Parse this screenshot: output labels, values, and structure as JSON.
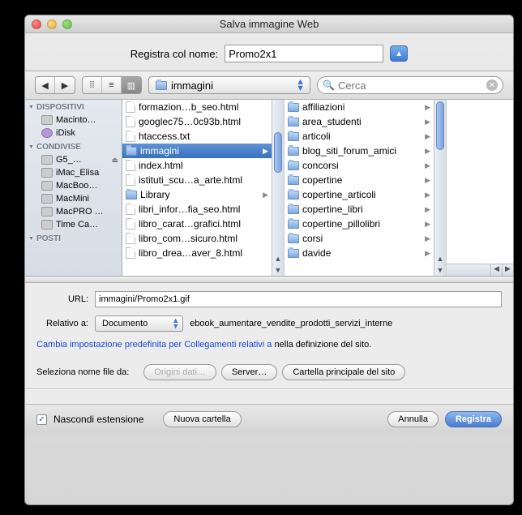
{
  "title": "Salva immagine Web",
  "name_label": "Registra col nome:",
  "name_value": "Promo2x1",
  "toolbar": {
    "path": "immagini",
    "search_placeholder": "Cerca"
  },
  "sidebar": {
    "devices_header": "DISPOSITIVI",
    "devices": [
      "Macinto…",
      "iDisk"
    ],
    "shared_header": "CONDIVISE",
    "shared": [
      "G5_…",
      "iMac_Elisa",
      "MacBoo…",
      "MacMini",
      "MacPRO …",
      "Time Ca…"
    ],
    "posts_header": "POSTI"
  },
  "col1": [
    {
      "name": "formazion…b_seo.html",
      "type": "file"
    },
    {
      "name": "googlec75…0c93b.html",
      "type": "file"
    },
    {
      "name": "htaccess.txt",
      "type": "file"
    },
    {
      "name": "immagini",
      "type": "folder",
      "selected": true
    },
    {
      "name": "index.html",
      "type": "file"
    },
    {
      "name": "istituti_scu…a_arte.html",
      "type": "file"
    },
    {
      "name": "Library",
      "type": "folder"
    },
    {
      "name": "libri_infor…fia_seo.html",
      "type": "file"
    },
    {
      "name": "libro_carat…grafici.html",
      "type": "file"
    },
    {
      "name": "libro_com…sicuro.html",
      "type": "file"
    },
    {
      "name": "libro_drea…aver_8.html",
      "type": "file"
    }
  ],
  "col2": [
    {
      "name": "affiliazioni"
    },
    {
      "name": "area_studenti"
    },
    {
      "name": "articoli"
    },
    {
      "name": "blog_siti_forum_amici"
    },
    {
      "name": "concorsi"
    },
    {
      "name": "copertine"
    },
    {
      "name": "copertine_articoli"
    },
    {
      "name": "copertine_libri"
    },
    {
      "name": "copertine_pillolibri"
    },
    {
      "name": "corsi"
    },
    {
      "name": "davide"
    }
  ],
  "bottom": {
    "url_label": "URL:",
    "url_value": "immagini/Promo2x1.gif",
    "relative_label": "Relativo a:",
    "relative_value": "Documento",
    "relative_path": "ebook_aumentare_vendite_prodotti_servizi_interne",
    "link_prefix": "Cambia impostazione predefinita per Collegamenti relativi a",
    "link_suffix": " nella definizione del sito.",
    "select_label": "Seleziona nome file da:",
    "btn_origini": "Origini dati…",
    "btn_server": "Server…",
    "btn_root": "Cartella principale del sito"
  },
  "footer": {
    "hide_ext": "Nascondi estensione",
    "new_folder": "Nuova cartella",
    "cancel": "Annulla",
    "save": "Registra"
  }
}
